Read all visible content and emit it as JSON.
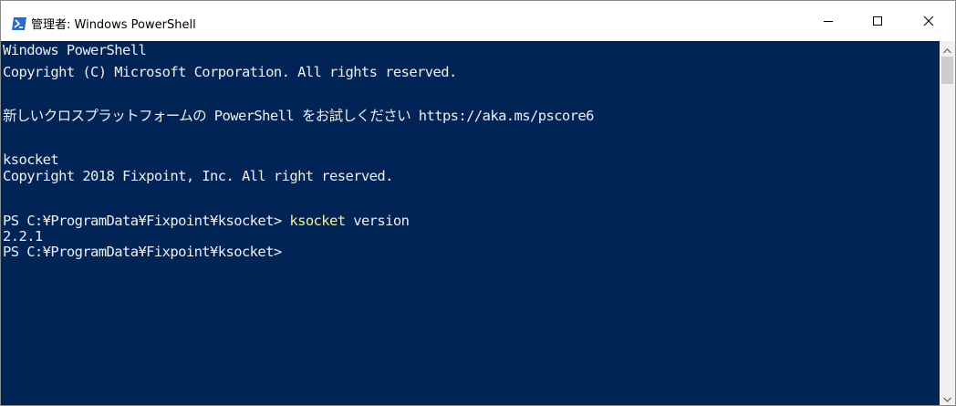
{
  "window": {
    "title": "管理者: Windows PowerShell",
    "icon": "powershell-icon",
    "controls": {
      "minimize": "minimize-icon",
      "maximize": "maximize-icon",
      "close": "close-icon"
    }
  },
  "console": {
    "lines": [
      "Windows PowerShell",
      "Copyright (C) Microsoft Corporation. All rights reserved.",
      "新しいクロスプラットフォームの PowerShell をお試しください https://aka.ms/pscore6",
      "ksocket",
      "Copyright 2018 Fixpoint, Inc. All right reserved.",
      "2.2.1",
      "PS C:¥ProgramData¥Fixpoint¥ksocket>"
    ],
    "command_line": {
      "prompt": "PS C:¥ProgramData¥Fixpoint¥ksocket> ",
      "command": "ksocket",
      "argument": " version"
    }
  },
  "colors": {
    "background": "#012456",
    "foreground": "#eeedf0",
    "command": "#f2f0a1"
  },
  "scrollbar": {
    "up": "chevron-up-icon",
    "down": "chevron-down-icon"
  }
}
